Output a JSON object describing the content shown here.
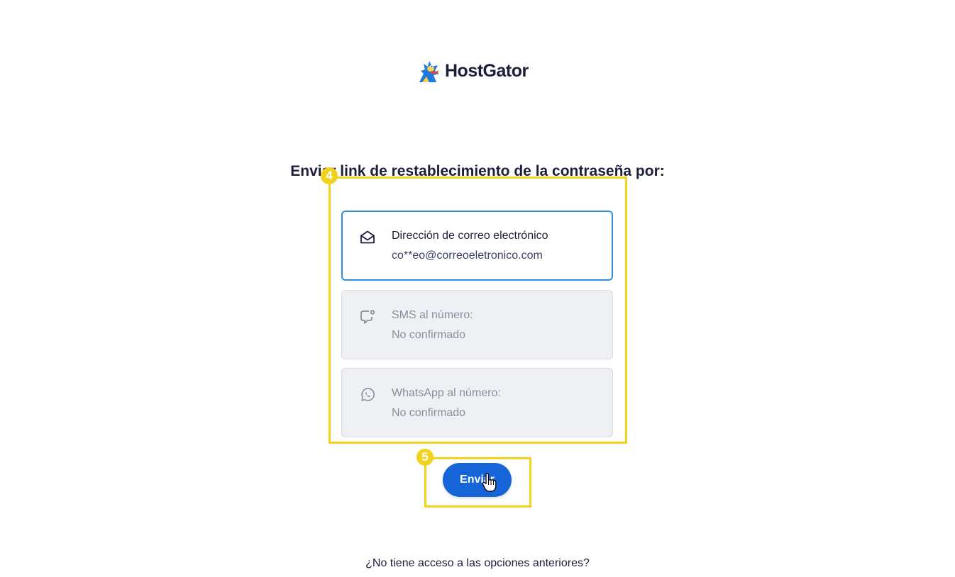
{
  "brand": {
    "name": "HostGator",
    "logo_icon": "gator-mascot-icon"
  },
  "heading": "Enviar link de restablecimiento de la contraseña por:",
  "options": [
    {
      "icon": "mail-open-icon",
      "title": "Dirección de correo electrónico",
      "value": "co**eo@correoeletronico.com",
      "state": "selected"
    },
    {
      "icon": "sms-chat-icon",
      "title": "SMS al número:",
      "value": "No confirmado",
      "state": "disabled"
    },
    {
      "icon": "whatsapp-icon",
      "title": "WhatsApp al número:",
      "value": "No confirmado",
      "state": "disabled"
    }
  ],
  "send_button": {
    "label": "Enviar"
  },
  "alt_link": {
    "label": "¿No tiene acceso a las opciones anteriores?"
  },
  "annotations": [
    {
      "number": "4"
    },
    {
      "number": "5"
    }
  ],
  "colors": {
    "accent": "#1565d8",
    "selected_border": "#2f8fe0",
    "annotation": "#f2d21c",
    "text": "#1b1f3b"
  }
}
